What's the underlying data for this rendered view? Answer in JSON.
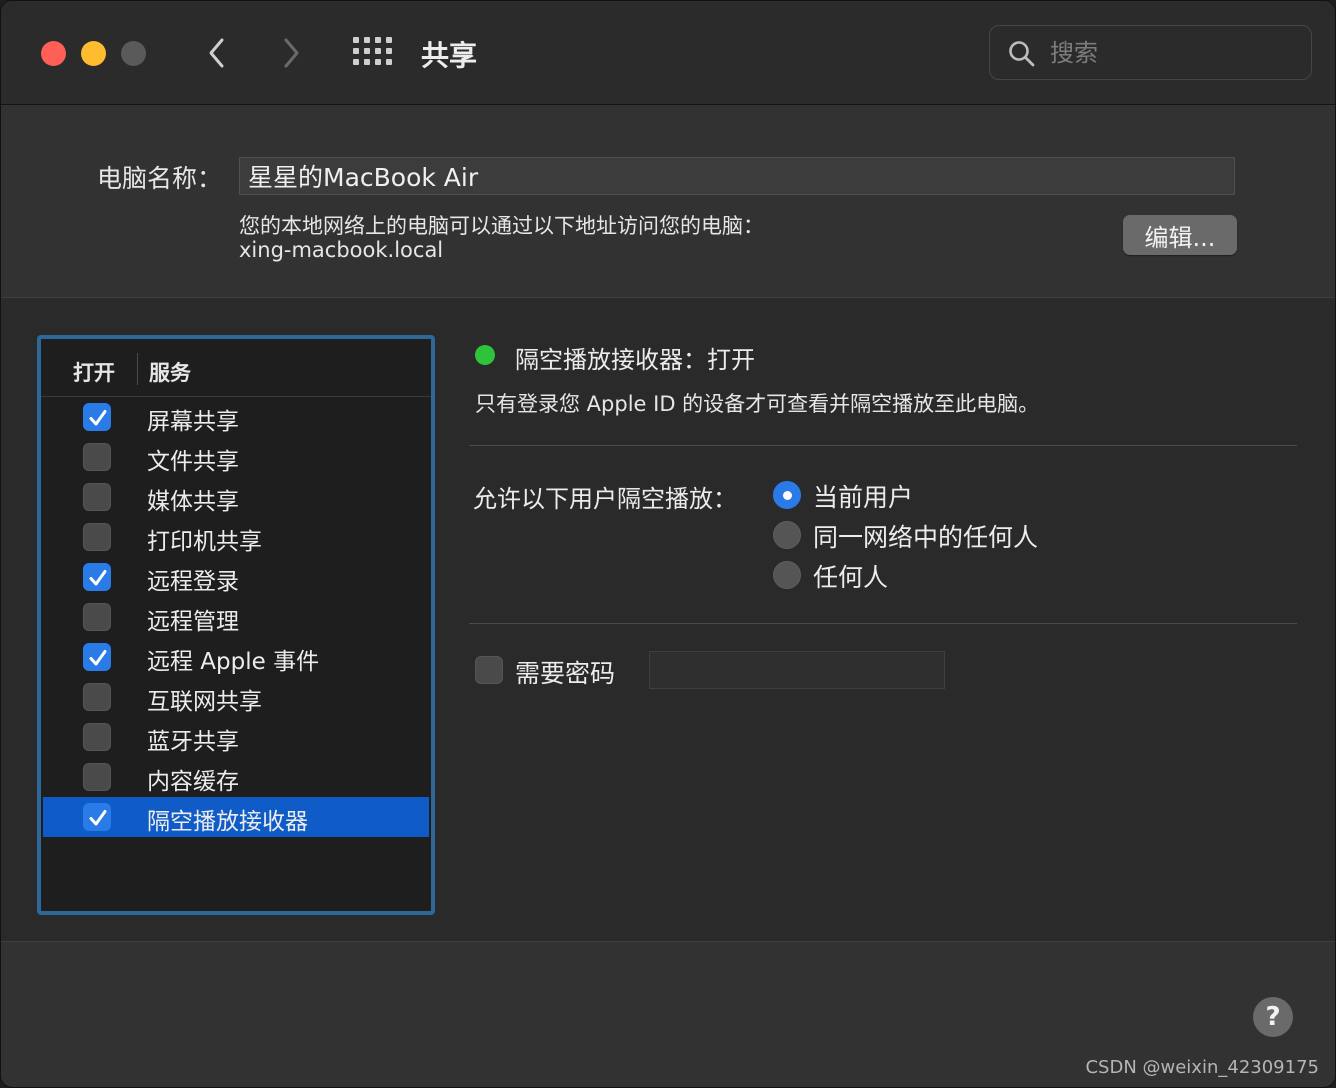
{
  "window": {
    "title": "共享"
  },
  "search": {
    "placeholder": "搜索"
  },
  "computer_name": {
    "label": "电脑名称：",
    "value": "星星的MacBook Air",
    "address_description": "您的本地网络上的电脑可以通过以下地址访问您的电脑：",
    "hostname": "xing-macbook.local",
    "edit_button": "编辑..."
  },
  "services": {
    "col_on": "打开",
    "col_service": "服务",
    "items": [
      {
        "label": "屏幕共享",
        "checked": true,
        "selected": false
      },
      {
        "label": "文件共享",
        "checked": false,
        "selected": false
      },
      {
        "label": "媒体共享",
        "checked": false,
        "selected": false
      },
      {
        "label": "打印机共享",
        "checked": false,
        "selected": false
      },
      {
        "label": "远程登录",
        "checked": true,
        "selected": false
      },
      {
        "label": "远程管理",
        "checked": false,
        "selected": false
      },
      {
        "label": "远程 Apple 事件",
        "checked": true,
        "selected": false
      },
      {
        "label": "互联网共享",
        "checked": false,
        "selected": false
      },
      {
        "label": "蓝牙共享",
        "checked": false,
        "selected": false
      },
      {
        "label": "内容缓存",
        "checked": false,
        "selected": false
      },
      {
        "label": "隔空播放接收器",
        "checked": true,
        "selected": true
      }
    ]
  },
  "detail": {
    "status": "隔空播放接收器：打开",
    "status_color": "#2ec43a",
    "description": "只有登录您 Apple ID 的设备才可查看并隔空播放至此电脑。",
    "allow_label": "允许以下用户隔空播放：",
    "options": [
      {
        "label": "当前用户",
        "selected": true
      },
      {
        "label": "同一网络中的任何人",
        "selected": false
      },
      {
        "label": "任何人",
        "selected": false
      }
    ],
    "require_password_label": "需要密码",
    "require_password_checked": false
  },
  "help_button": "?",
  "watermark": "CSDN @weixin_42309175",
  "colors": {
    "accent": "#2a7be8",
    "selection": "#0f5cc8",
    "list_border": "#2e6898"
  }
}
